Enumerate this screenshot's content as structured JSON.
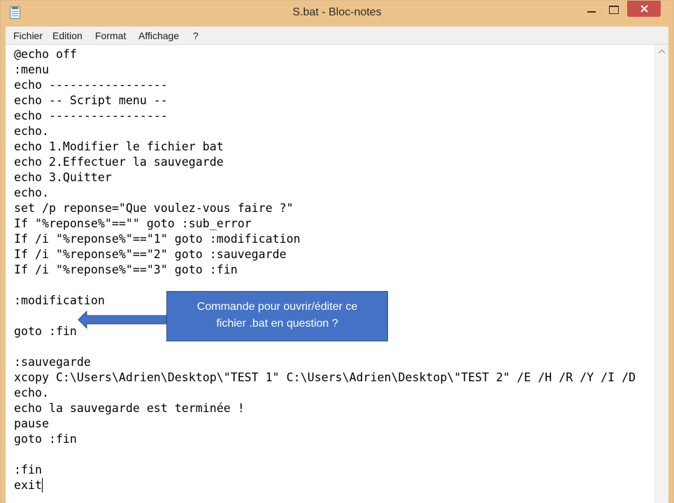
{
  "window": {
    "title": "S.bat - Bloc-notes",
    "frame_color": "#edc28a",
    "close_color": "#c7504a",
    "icons": [
      "notepad-icon",
      "minimize-icon",
      "maximize-icon",
      "close-icon"
    ]
  },
  "menu": {
    "items": [
      "Fichier",
      "Edition",
      "Format",
      "Affichage",
      "?"
    ]
  },
  "editor": {
    "lines": [
      "@echo off",
      ":menu",
      "echo -----------------",
      "echo -- Script menu --",
      "echo -----------------",
      "echo.",
      "echo 1.Modifier le fichier bat",
      "echo 2.Effectuer la sauvegarde",
      "echo 3.Quitter",
      "echo.",
      "set /p reponse=\"Que voulez-vous faire ?\"",
      "If \"%reponse%\"==\"\" goto :sub_error",
      "If /i \"%reponse%\"==\"1\" goto :modification",
      "If /i \"%reponse%\"==\"2\" goto :sauvegarde",
      "If /i \"%reponse%\"==\"3\" goto :fin",
      "",
      ":modification",
      "",
      "goto :fin",
      "",
      ":sauvegarde",
      "xcopy C:\\Users\\Adrien\\Desktop\\\"TEST 1\" C:\\Users\\Adrien\\Desktop\\\"TEST 2\" /E /H /R /Y /I /D",
      "echo.",
      "echo la sauvegarde est terminée !",
      "pause",
      "goto :fin",
      "",
      ":fin",
      "exit"
    ]
  },
  "callout": {
    "line1": "Commande pour ouvrir/éditer ce",
    "line2": "fichier .bat en question ?",
    "color": "#4472c4"
  }
}
